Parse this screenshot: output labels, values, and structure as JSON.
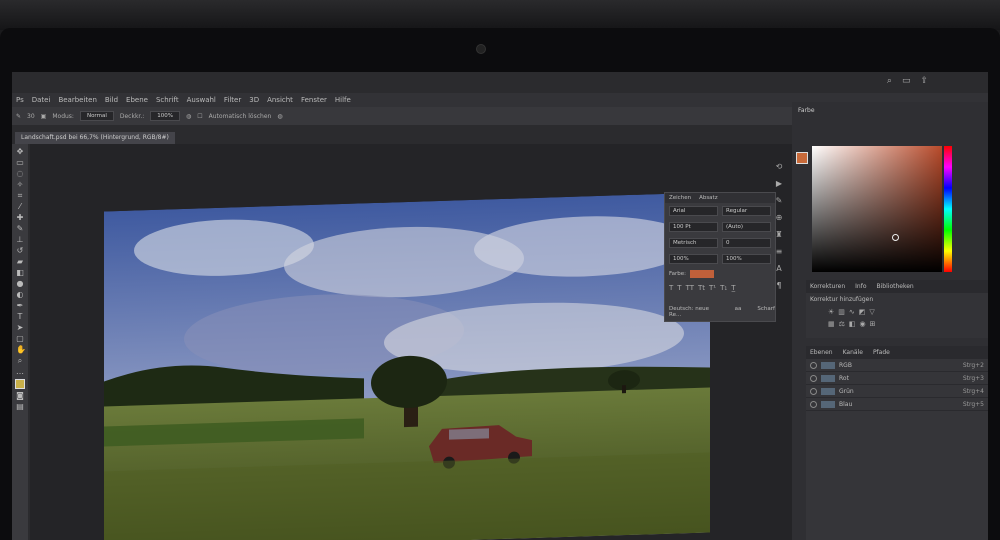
{
  "menu": [
    "Ps",
    "Datei",
    "Bearbeiten",
    "Bild",
    "Ebene",
    "Schrift",
    "Auswahl",
    "Filter",
    "3D",
    "Ansicht",
    "Fenster",
    "Hilfe"
  ],
  "options": {
    "brush_size": "30",
    "mode_label": "Modus:",
    "mode_value": "Normal",
    "opacity_label": "Deckkr.:",
    "opacity_value": "100%",
    "auto_erase": "Automatisch löschen"
  },
  "document_tab": "Landschaft.psd bei 66,7% (Hintergrund, RGB/8#)",
  "character_panel": {
    "tabs": [
      "Zeichen",
      "Absatz"
    ],
    "font": "Arial",
    "style": "Regular",
    "size": "100 Pt",
    "leading": "(Auto)",
    "kerning": "Metrisch",
    "tracking": "0",
    "vscale": "100%",
    "hscale": "100%",
    "color_label": "Farbe:",
    "language": "Deutsch: neue Re...",
    "aa_label": "aa",
    "antialias": "Scharf",
    "color_hex": "#c0603a"
  },
  "color_panel": {
    "title": "Farbe"
  },
  "adjustments_panel": {
    "tabs": [
      "Korrekturen",
      "Info",
      "Bibliotheken"
    ],
    "label": "Korrektur hinzufügen"
  },
  "layers_panel": {
    "tabs": [
      "Ebenen",
      "Kanäle",
      "Pfade"
    ],
    "rows": [
      {
        "name": "RGB",
        "shortcut": "Strg+2"
      },
      {
        "name": "Rot",
        "shortcut": "Strg+3"
      },
      {
        "name": "Grün",
        "shortcut": "Strg+4"
      },
      {
        "name": "Blau",
        "shortcut": "Strg+5"
      }
    ]
  }
}
